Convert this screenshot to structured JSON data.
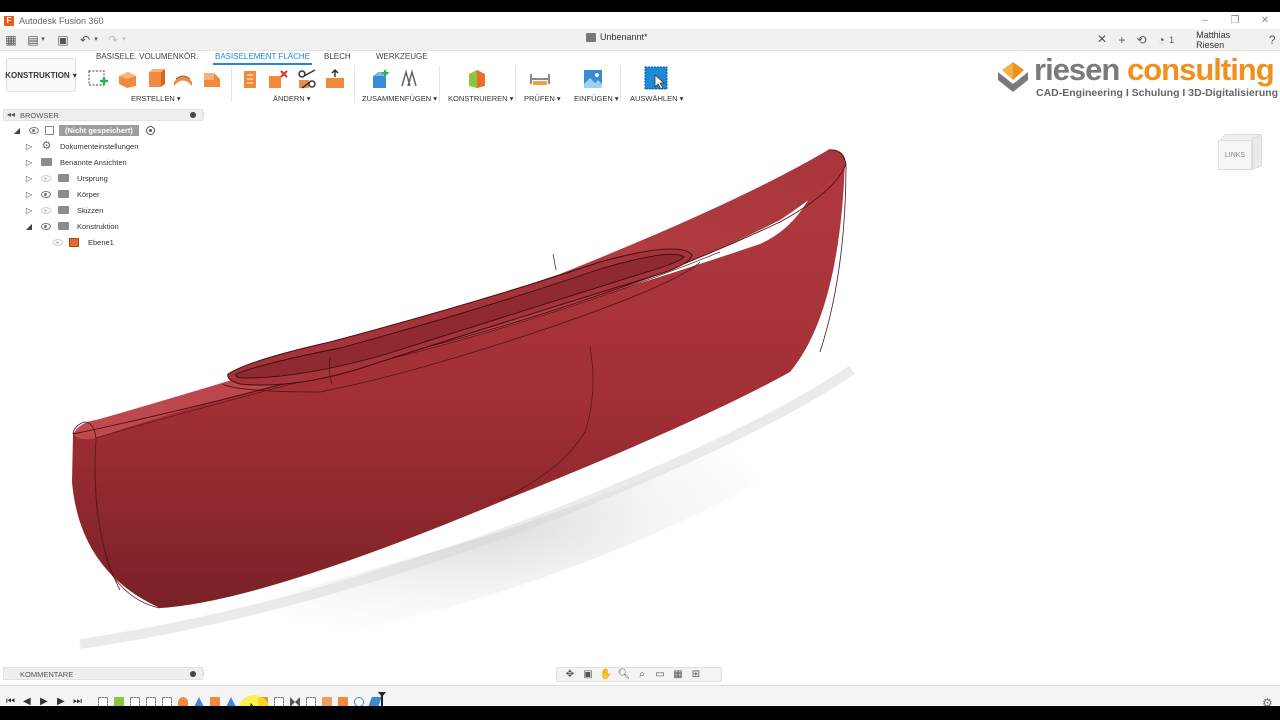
{
  "window": {
    "app_title": "Autodesk Fusion 360",
    "doc_title": "Unbenannt*",
    "job_count": "1",
    "user_name": "Matthias Riesen"
  },
  "ribbon": {
    "workspace": "KONSTRUKTION",
    "tabs": [
      {
        "label": "BASISELE. VOLUMENKÖR.",
        "active": false
      },
      {
        "label": "BASISELEMENT FLÄCHE",
        "active": true
      },
      {
        "label": "BLECH",
        "active": false
      },
      {
        "label": "WERKZEUGE",
        "active": false
      }
    ],
    "groups": [
      "ERSTELLEN",
      "ÄNDERN",
      "ZUSAMMENFÜGEN",
      "KONSTRUIEREN",
      "PRÜFEN",
      "EINFÜGEN",
      "AUSWÄHLEN"
    ],
    "accent_color": "#1c8ad8"
  },
  "logo": {
    "brand_part1": "riesen",
    "brand_part2": "consulting",
    "tagline": "CAD-Engineering I Schulung I 3D-Digitalisierung",
    "grey": "#7a7a7a",
    "orange": "#f0901e"
  },
  "browser": {
    "title": "BROWSER",
    "root_label": "(Nicht gespeichert)",
    "items": [
      {
        "label": "Dokumenteinstellungen",
        "icon": "gear-icon"
      },
      {
        "label": "Benannte Ansichten",
        "icon": "folder-icon"
      },
      {
        "label": "Ursprung",
        "icon": "folder-icon",
        "visible": false
      },
      {
        "label": "Körper",
        "icon": "folder-icon",
        "visible": true
      },
      {
        "label": "Skizzen",
        "icon": "folder-icon",
        "visible": false
      },
      {
        "label": "Konstruktion",
        "icon": "folder-icon",
        "visible": true,
        "expanded": true
      },
      {
        "label": "Ebene1",
        "icon": "construction-plane-icon",
        "visible": false
      }
    ]
  },
  "viewcube": {
    "face_label": "LINKS"
  },
  "comments": {
    "title": "KOMMENTARE"
  },
  "model": {
    "body_color": "#b0353c",
    "shape": "kayak-hull"
  }
}
